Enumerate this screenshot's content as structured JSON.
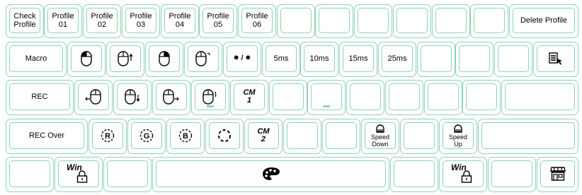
{
  "row1": {
    "check_profile": "Check\nProfile",
    "profiles": [
      "Profile\n01",
      "Profile\n02",
      "Profile\n03",
      "Profile\n04",
      "Profile\n05",
      "Profile\n06"
    ],
    "delete_profile": "Delete Profile"
  },
  "row2": {
    "macro": "Macro",
    "blink": "✸ / ✸",
    "delays": [
      "5ms",
      "10ms",
      "15ms",
      "25ms"
    ]
  },
  "row3": {
    "rec": "REC",
    "cm1": "CM\n1"
  },
  "row4": {
    "rec_over": "REC Over",
    "cm2": "CM\n2",
    "speed_down": "Speed\nDown",
    "speed_up": "Speed\nUp"
  },
  "row5": {
    "win_left": "Win",
    "win_right": "Win"
  },
  "icons": {
    "mouse_left": "mouse-left-click-icon",
    "mouse_right": "mouse-right-click-icon",
    "mouse_middle": "mouse-middle-click-icon",
    "scroll_up": "mouse-scroll-up-icon",
    "scroll_down": "mouse-scroll-down-icon",
    "mouse_back": "mouse-back-icon",
    "mouse_forward": "mouse-forward-icon",
    "lock": "lock-icon",
    "palette": "palette-icon",
    "store": "store-icon",
    "menu": "menu-cursor-icon",
    "rgb_r": "rgb-red-icon",
    "rgb_g": "rgb-green-icon",
    "rgb_b": "rgb-blue-icon",
    "spinner": "loading-ring-icon",
    "speed_gauge": "speed-gauge-icon"
  },
  "colors": {
    "key_border": "#8fd3b3",
    "background": "#ffffff"
  }
}
